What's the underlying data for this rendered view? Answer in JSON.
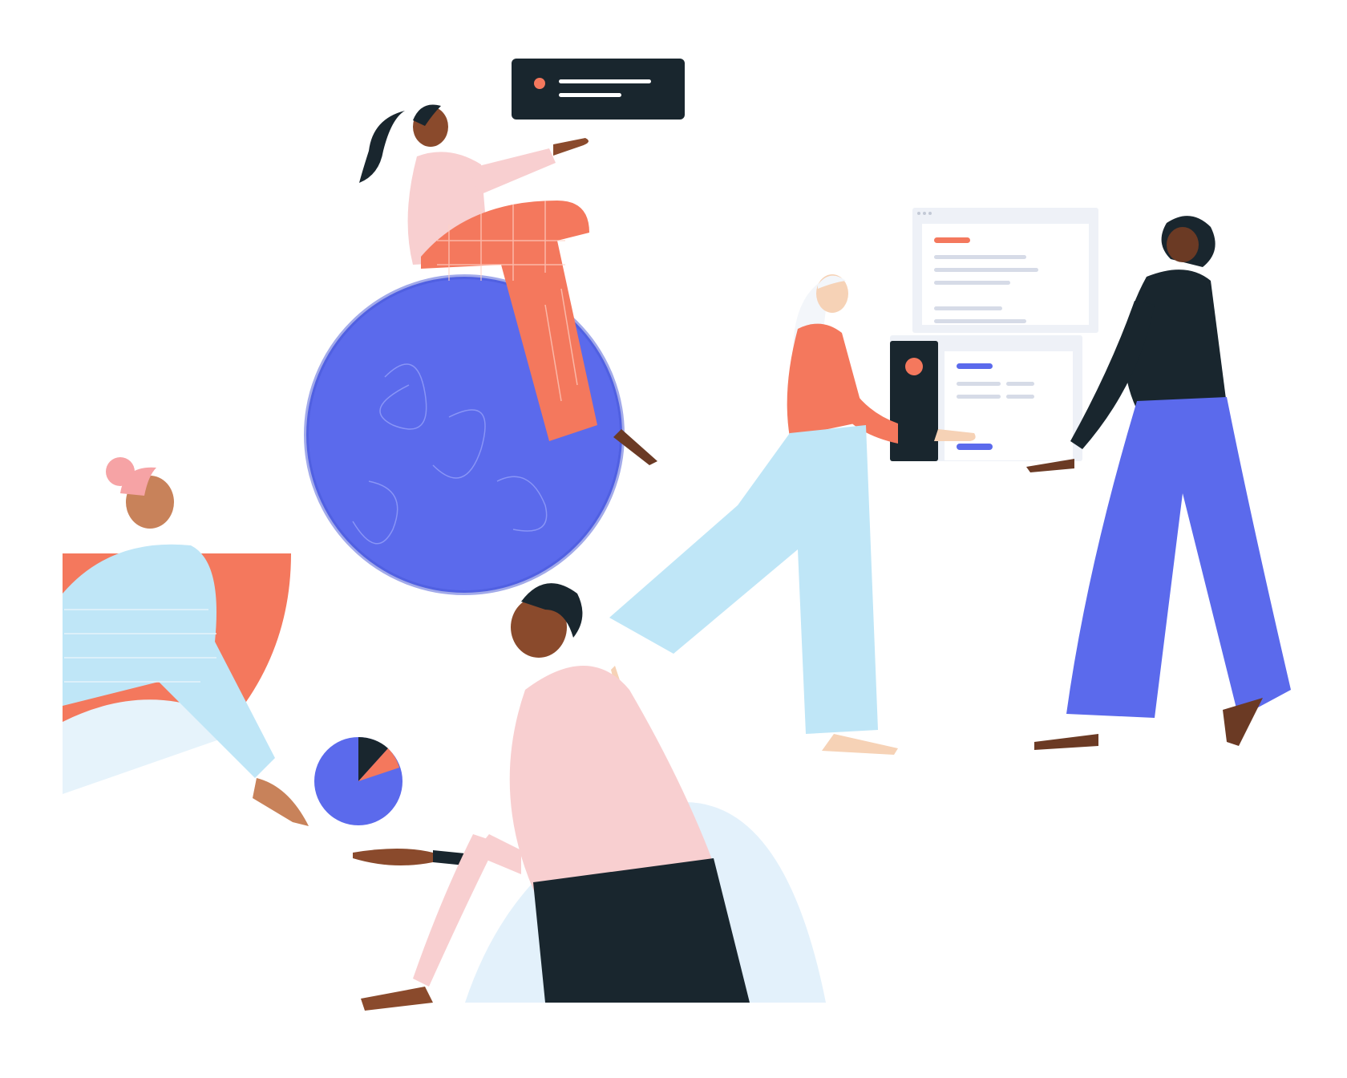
{
  "scene": {
    "name": "team-collaboration-illustration",
    "elements": {
      "speech_card": "message-card",
      "big_ball": "blue-sphere",
      "pie_ball": "pie-chart-ball",
      "window_top": "browser-window",
      "window_bottom": "data-card"
    }
  },
  "colors": {
    "background": "#ffffff",
    "navy": "#19262e",
    "coral": "#f4785d",
    "blue": "#5b6aec",
    "pink": "#f8cfd0",
    "light_blue": "#bfe6f7",
    "skin_dark": "#6b3a24",
    "skin_mid": "#b06a44",
    "skin_light": "#f2c7a6",
    "panel": "#eef1f7",
    "panel_line": "#d6dbe7"
  }
}
